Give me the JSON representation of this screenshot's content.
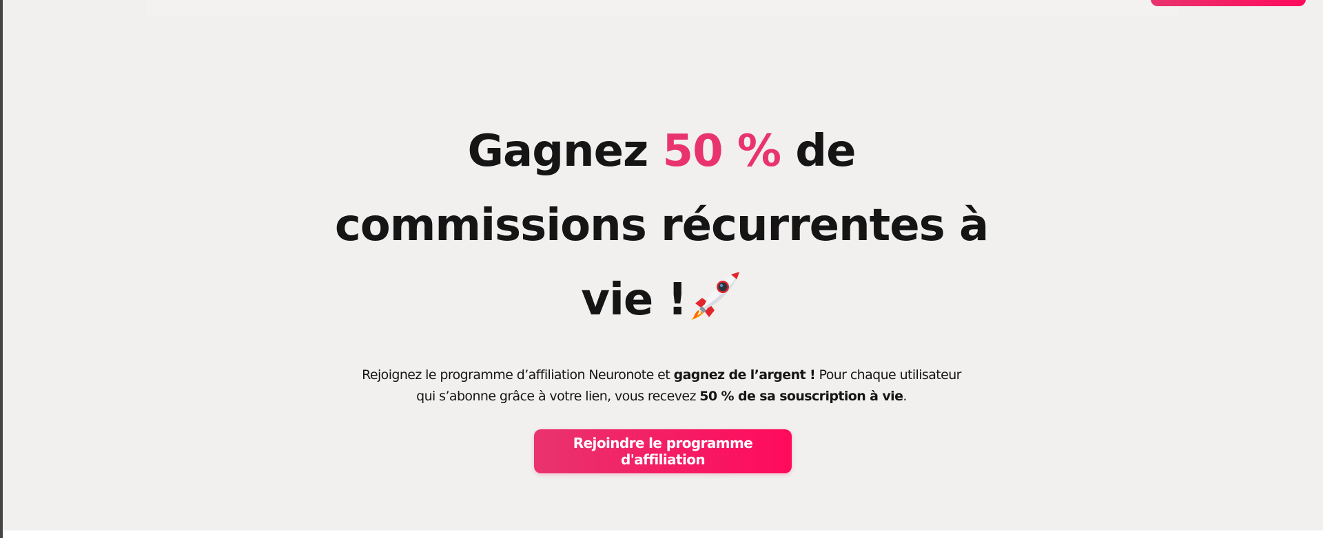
{
  "hero": {
    "title_part1": "Gagnez ",
    "title_accent": "50 %",
    "title_part2": " de commissions récurrentes à vie !",
    "rocket_icon": "rocket-icon",
    "subtitle_part1": "Rejoignez le programme d’affiliation Neuronote et ",
    "subtitle_bold1": "gagnez de l’argent !",
    "subtitle_part2": " Pour chaque utilisateur qui s’abonne grâce à votre lien, vous recevez ",
    "subtitle_bold2": "50 % de sa souscription à vie",
    "subtitle_end": ".",
    "cta_label": "Rejoindre le programme d'affiliation"
  },
  "colors": {
    "accent": "#e9336f",
    "button_gradient_end": "#ff0a5c",
    "background": "#f1f0ee",
    "text": "#151515"
  }
}
